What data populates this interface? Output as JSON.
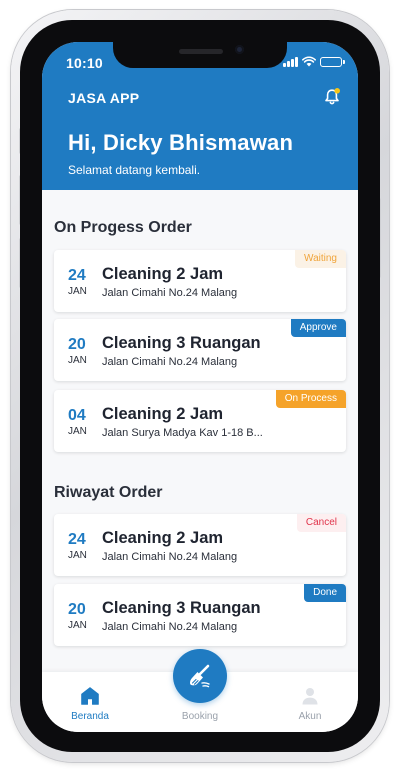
{
  "status_bar": {
    "time": "10:10"
  },
  "header": {
    "app_title": "JASA APP",
    "greeting": "Hi, Dicky Bhismawan",
    "subtitle": "Selamat datang kembali."
  },
  "sections": {
    "in_progress_title": "On Progess Order",
    "history_title": "Riwayat Order"
  },
  "in_progress_orders": [
    {
      "day": "24",
      "month": "JAN",
      "title": "Cleaning 2 Jam",
      "address": "Jalan Cimahi No.24 Malang",
      "status": "Waiting"
    },
    {
      "day": "20",
      "month": "JAN",
      "title": "Cleaning 3 Ruangan",
      "address": "Jalan Cimahi No.24 Malang",
      "status": "Approve"
    },
    {
      "day": "04",
      "month": "JAN",
      "title": "Cleaning 2 Jam",
      "address": "Jalan Surya Madya Kav 1-18 B...",
      "status": "On Process"
    }
  ],
  "history_orders": [
    {
      "day": "24",
      "month": "JAN",
      "title": "Cleaning 2 Jam",
      "address": "Jalan Cimahi No.24 Malang",
      "status": "Cancel"
    },
    {
      "day": "20",
      "month": "JAN",
      "title": "Cleaning 3 Ruangan",
      "address": "Jalan Cimahi No.24 Malang",
      "status": "Done"
    }
  ],
  "bottom_nav": {
    "home_label": "Beranda",
    "booking_label": "Booking",
    "account_label": "Akun"
  },
  "icons": {
    "bell": "bell-icon",
    "home": "home-icon",
    "booking": "broom-icon",
    "account": "user-icon"
  },
  "colors": {
    "primary": "#1f7bc2",
    "waiting": "#f0a43a",
    "on_process": "#f5a32a",
    "cancel": "#e0344b",
    "notification_dot": "#f5c518"
  }
}
